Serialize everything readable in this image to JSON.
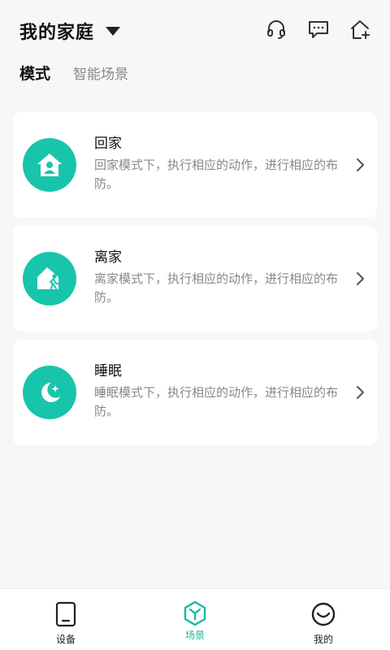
{
  "header": {
    "home_title": "我的家庭",
    "icons": [
      "headset-icon",
      "message-icon",
      "add-home-icon"
    ]
  },
  "tabs": [
    {
      "label": "模式",
      "active": true
    },
    {
      "label": "智能场景",
      "active": false
    }
  ],
  "modes": [
    {
      "title": "回家",
      "description": "回家模式下，执行相应的动作，进行相应的布防。",
      "icon": "home-person-icon"
    },
    {
      "title": "离家",
      "description": "离家模式下，执行相应的动作，进行相应的布防。",
      "icon": "leave-home-icon"
    },
    {
      "title": "睡眠",
      "description": "睡眠模式下，执行相应的动作，进行相应的布防。",
      "icon": "moon-star-icon"
    }
  ],
  "bottom_nav": [
    {
      "label": "设备",
      "icon": "device-icon",
      "active": false
    },
    {
      "label": "场景",
      "icon": "scene-icon",
      "active": true
    },
    {
      "label": "我的",
      "icon": "smile-face-icon",
      "active": false
    }
  ],
  "colors": {
    "accent": "#18c5ab",
    "nav_active": "#18b8a6",
    "background": "#f7f7f7",
    "card": "#ffffff"
  }
}
